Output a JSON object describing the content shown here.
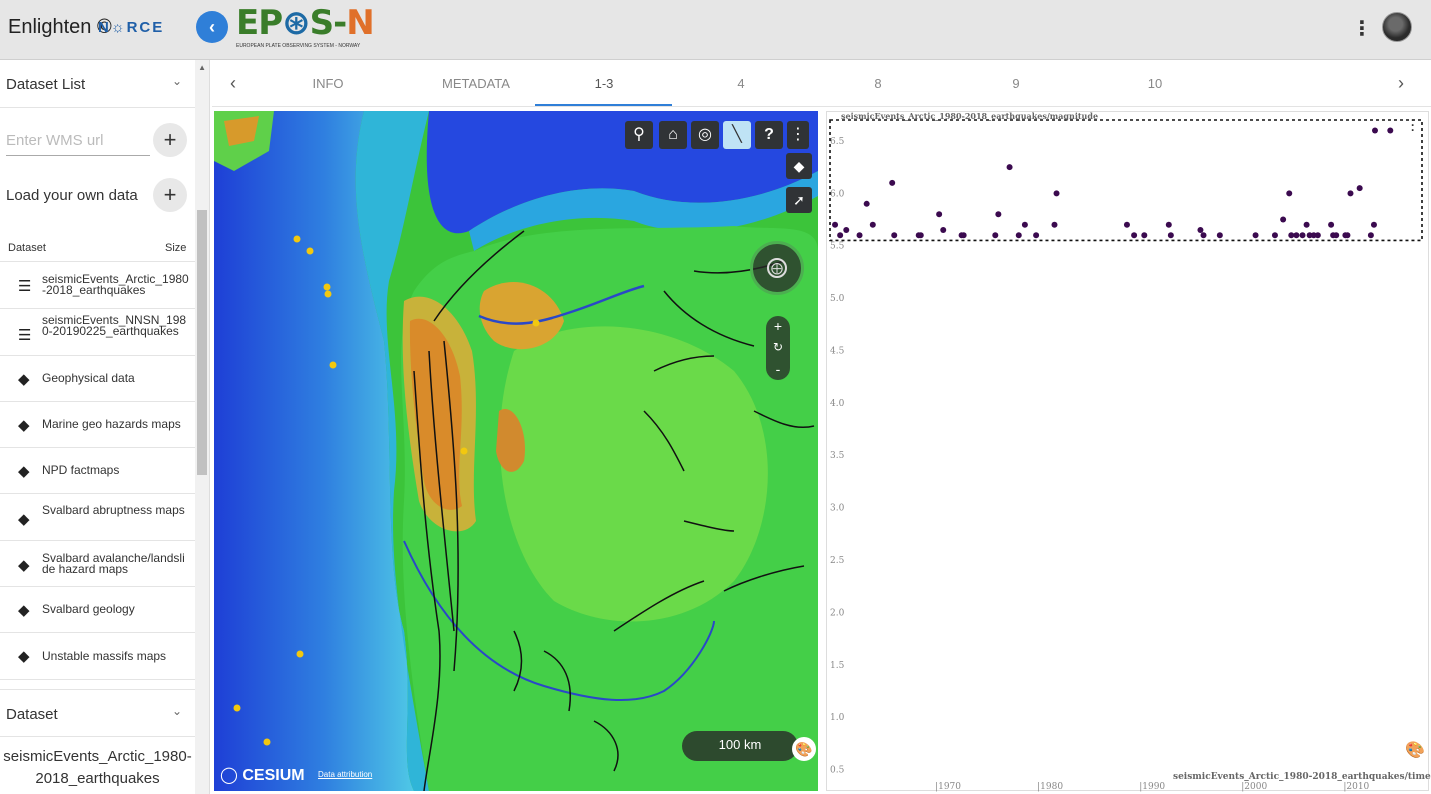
{
  "app": {
    "title": "Enlighten ©",
    "norce": "N☼RCE",
    "logo_main": "EPOS-N",
    "logo_sub": "EUROPEAN PLATE OBSERVING SYSTEM  -  NORWAY"
  },
  "topbar": {
    "collapse_icon": "‹",
    "kebab": "⋮"
  },
  "sidebar": {
    "dataset_list_label": "Dataset List",
    "wms_placeholder": "Enter WMS url",
    "load_label": "Load your own data",
    "plus": "+",
    "col_dataset": "Dataset",
    "col_size": "Size",
    "items": [
      {
        "label": "seismicEvents_Arctic_1980-2018_earthquakes",
        "icon": "table-icon"
      },
      {
        "label": "seismicEvents_NNSN_1980-20190225_earthquakes",
        "icon": "table-icon"
      },
      {
        "label": "Geophysical data",
        "icon": "layers-icon"
      },
      {
        "label": "Marine geo hazards maps",
        "icon": "layers-icon"
      },
      {
        "label": "NPD factmaps",
        "icon": "layers-icon"
      },
      {
        "label": "Svalbard abruptness maps",
        "icon": "layers-icon"
      },
      {
        "label": "Svalbard avalanche/landslide hazard maps",
        "icon": "layers-icon"
      },
      {
        "label": "Svalbard geology",
        "icon": "layers-icon"
      },
      {
        "label": "Unstable massifs maps",
        "icon": "layers-icon"
      }
    ],
    "dataset_label": "Dataset",
    "selected_dataset": "seismicEvents_Arctic_1980-2018_earthquakes"
  },
  "tabs": {
    "items": [
      "INFO",
      "METADATA",
      "1-3",
      "4",
      "8",
      "9",
      "10"
    ],
    "active": "1-3",
    "prev": "‹",
    "next": "›"
  },
  "map": {
    "toolbar_icons": [
      "search-icon",
      "home-icon",
      "globe-icon",
      "measure-icon",
      "help-icon",
      "more-icon"
    ],
    "scale": "100 km",
    "cesium": "CESIUM",
    "attribution": "Data attribution"
  },
  "chart_data": {
    "type": "scatter",
    "title": "seismicEvents_Arctic_1980-2018_earthquakes/magnitude",
    "xlabel": "seismicEvents_Arctic_1980-2018_earthquakes/time→",
    "ylabel": "",
    "x_ticks": [
      "1970",
      "1980",
      "1990",
      "2000",
      "2010"
    ],
    "y_ticks": [
      "0.5",
      "1.0",
      "1.5",
      "2.0",
      "2.5",
      "3.0",
      "3.5",
      "4.0",
      "4.5",
      "5.0",
      "5.5",
      "6.0",
      "6.5"
    ],
    "ylim": [
      0.4,
      6.7
    ],
    "xlim": [
      1960,
      2018
    ],
    "marker_color": "#3b0a4f",
    "series": [
      {
        "x": [
          1960.2,
          1960.7,
          1961.3,
          1962.6,
          1963.3,
          1963.9,
          1965.8,
          1966.0,
          1968.4,
          1968.6,
          1970.4,
          1970.8,
          1972.6,
          1972.8,
          1975.9,
          1976.2,
          1977.3,
          1978.2,
          1978.8,
          1979.9,
          1981.7,
          1981.9,
          1988.8,
          1989.5,
          1990.5,
          1992.9,
          1993.1,
          1996.0,
          1996.3,
          1997.9,
          2001.4,
          2003.3,
          2004.1,
          2004.7,
          2004.9,
          2005.4,
          2006.0,
          2006.4,
          2006.7,
          2007.1,
          2007.5,
          2008.8,
          2009.0,
          2009.3,
          2010.2,
          2010.4,
          2010.7,
          2011.6,
          2012.7,
          2013.0,
          2013.1,
          2014.6
        ],
        "y": [
          5.7,
          5.6,
          5.65,
          5.6,
          5.9,
          5.7,
          6.1,
          5.6,
          5.6,
          5.6,
          5.8,
          5.65,
          5.6,
          5.6,
          5.6,
          5.8,
          6.25,
          5.6,
          5.7,
          5.6,
          5.7,
          6.0,
          5.7,
          5.6,
          5.6,
          5.7,
          5.6,
          5.65,
          5.6,
          5.6,
          5.6,
          5.6,
          5.75,
          6.0,
          5.6,
          5.6,
          5.6,
          5.7,
          5.6,
          5.6,
          5.6,
          5.7,
          5.6,
          5.6,
          5.6,
          5.6,
          6.0,
          6.05,
          5.6,
          5.7,
          6.6,
          6.6
        ]
      }
    ]
  }
}
